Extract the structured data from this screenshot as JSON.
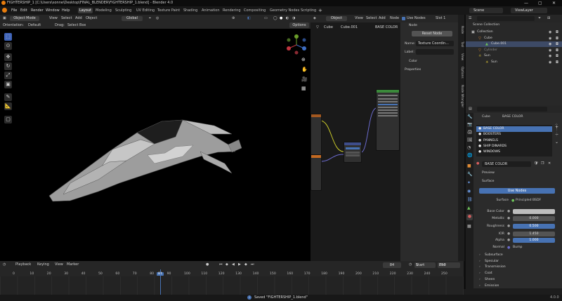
{
  "window": {
    "title": "FIGHTERSHIP_1 [C:\\Users\\sonne\\Desktop\\FINAL_BLENDER\\FIGHTERSHIP_1.blend] - Blender 4.0",
    "min": "—",
    "max": "▢",
    "close": "✕"
  },
  "menu": [
    "File",
    "Edit",
    "Render",
    "Window",
    "Help"
  ],
  "workspaces": [
    "Layout",
    "Modeling",
    "Sculpting",
    "UV Editing",
    "Texture Paint",
    "Shading",
    "Animation",
    "Rendering",
    "Compositing",
    "Geometry Nodes",
    "Scripting"
  ],
  "active_workspace": "Layout",
  "scene": {
    "scene_name": "Scene",
    "view_layer": "ViewLayer"
  },
  "viewport_header": {
    "mode": "Object Mode",
    "view": "View",
    "select": "Select",
    "add": "Add",
    "object": "Object",
    "transform": "Global",
    "orientation_label": "Orientation:",
    "orientation_value": "Default",
    "drag_label": "Drag:",
    "drag_value": "Select Box",
    "options": "Options"
  },
  "node_header": {
    "type": "Object",
    "view": "View",
    "select": "Select",
    "add": "Add",
    "node": "Node",
    "use_nodes": "Use Nodes",
    "slot": "Slot 1",
    "bc_object": "Cube",
    "bc_mesh": "Cube.001",
    "bc_material": "BASE COLOR"
  },
  "node_sidebar": {
    "section": "Node",
    "reset": "Reset Node",
    "name_label": "Name:",
    "name_value": "Texture Coordin...",
    "label_label": "Label:",
    "color": "Color",
    "properties": "Properties",
    "tabs": [
      "Node",
      "Tool",
      "View",
      "Options",
      "Node Wrangler"
    ]
  },
  "outliner": {
    "root": "Scene Collection",
    "items": [
      {
        "label": "Collection",
        "indent": 0
      },
      {
        "label": "Cube",
        "indent": 1
      },
      {
        "label": "Cube.001",
        "indent": 2
      },
      {
        "label": "Cylinder",
        "indent": 1
      },
      {
        "label": "Sun",
        "indent": 1
      },
      {
        "label": "Sun",
        "indent": 2
      }
    ]
  },
  "properties": {
    "obj": "Cube",
    "mat": "BASE COLOR",
    "slots": [
      "BASE COLOR",
      "BOOSTERS",
      "PANNELS",
      "SHIP DINARDS",
      "WINDOWS"
    ],
    "material_field": "BASE COLOR",
    "preview": "Preview",
    "surface_section": "Surface",
    "use_nodes": "Use Nodes",
    "surface_label": "Surface",
    "surface_value": "Principled BSDF",
    "rows": [
      {
        "label": "Base Color",
        "value": ""
      },
      {
        "label": "Metallic",
        "value": "0.000"
      },
      {
        "label": "Roughness",
        "value": "0.500"
      },
      {
        "label": "IOR",
        "value": "1.450"
      },
      {
        "label": "Alpha",
        "value": "1.000"
      }
    ],
    "normal_label": "Normal",
    "normal_value": "Bump",
    "subsections": [
      "Subsurface",
      "Specular",
      "Transmission",
      "Coat",
      "Sheen",
      "Emission"
    ]
  },
  "timeline": {
    "menus": [
      "Playback",
      "Keying",
      "View",
      "Marker"
    ],
    "current_frame": "84",
    "start_label": "Start",
    "start": "1",
    "end_label": "End",
    "end": "250",
    "ticks": [
      "0",
      "10",
      "20",
      "30",
      "40",
      "50",
      "60",
      "70",
      "80",
      "84",
      "90",
      "100",
      "110",
      "120",
      "130",
      "140",
      "150",
      "160",
      "170",
      "180",
      "190",
      "200",
      "210",
      "220",
      "230",
      "240",
      "250"
    ]
  },
  "status": {
    "saved": "Saved \"FIGHTERSHIP_1.blend\"",
    "version": "4.0.0"
  },
  "colors": {
    "accent": "#4772b3",
    "bg": "#1d1d1d",
    "header": "#262626",
    "panel": "#303030"
  }
}
